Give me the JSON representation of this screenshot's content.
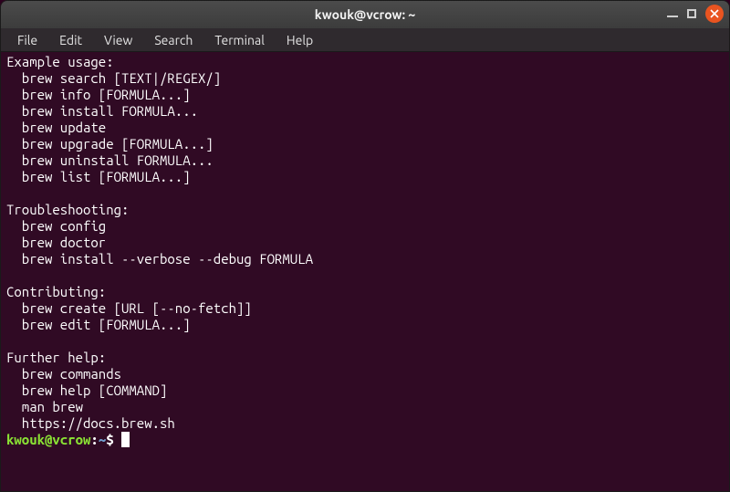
{
  "window": {
    "title": "kwouk@vcrow: ~",
    "controls": {
      "minimize": "minimize",
      "maximize": "maximize",
      "close": "close"
    }
  },
  "menubar": {
    "items": [
      "File",
      "Edit",
      "View",
      "Search",
      "Terminal",
      "Help"
    ]
  },
  "terminal": {
    "lines": [
      "Example usage:",
      "  brew search [TEXT|/REGEX/]",
      "  brew info [FORMULA...]",
      "  brew install FORMULA...",
      "  brew update",
      "  brew upgrade [FORMULA...]",
      "  brew uninstall FORMULA...",
      "  brew list [FORMULA...]",
      "",
      "Troubleshooting:",
      "  brew config",
      "  brew doctor",
      "  brew install --verbose --debug FORMULA",
      "",
      "Contributing:",
      "  brew create [URL [--no-fetch]]",
      "  brew edit [FORMULA...]",
      "",
      "Further help:",
      "  brew commands",
      "  brew help [COMMAND]",
      "  man brew",
      "  https://docs.brew.sh"
    ],
    "prompt": {
      "user_host": "kwouk@vcrow",
      "sep": ":",
      "path": "~",
      "sigil": "$"
    }
  }
}
